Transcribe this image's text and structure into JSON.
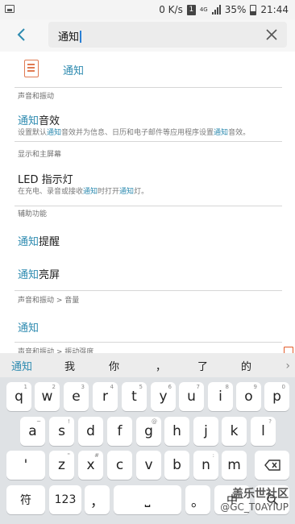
{
  "status_bar": {
    "speed": "0 K/s",
    "sim": "1",
    "network": "4G",
    "battery": "35%",
    "time": "21:44"
  },
  "search": {
    "query": "通知"
  },
  "top_result": {
    "title": "通知"
  },
  "results": [
    {
      "section": "声音和振动",
      "title_hl": "通知",
      "title_rest": "音效",
      "sub_parts": [
        "设置默认",
        "通知",
        "音效并为信息、日历和电子邮件等应用程序设置",
        "通知",
        "音效。"
      ]
    },
    {
      "section": "显示和主屏幕",
      "title": "LED 指示灯",
      "sub_parts": [
        "在充电、录音或接收",
        "通知",
        "时打开",
        "通知",
        "灯。"
      ]
    },
    {
      "section": "辅助功能",
      "title_hl": "通知",
      "title_rest": "提醒"
    },
    {
      "title_hl": "通知",
      "title_rest": "亮屏"
    },
    {
      "section": "声音和振动 > 音量",
      "title_hl": "通知"
    },
    {
      "section": "声音和振动 > 振动强度"
    }
  ],
  "keyboard": {
    "suggestions": [
      "通知",
      "我",
      "你",
      "，",
      "了",
      "的"
    ],
    "more": "›",
    "row1": [
      "q",
      "w",
      "e",
      "r",
      "t",
      "y",
      "u",
      "i",
      "o",
      "p"
    ],
    "row1_hints": [
      "1",
      "2",
      "3",
      "4",
      "5",
      "6",
      "7",
      "8",
      "9",
      "0"
    ],
    "row2": [
      "a",
      "s",
      "d",
      "f",
      "g",
      "h",
      "j",
      "k",
      "l"
    ],
    "row2_hints": [
      "~",
      "!",
      "",
      "",
      "@",
      "",
      "",
      "",
      "?"
    ],
    "row3": [
      "'",
      "z",
      "x",
      "c",
      "v",
      "b",
      "n",
      "m"
    ],
    "row3_hints": [
      "",
      "\"",
      "#",
      "",
      "",
      "",
      ":",
      ""
    ],
    "symbols": "符",
    "numbers": "123",
    "comma": "，",
    "period": "。",
    "lang": "中",
    "space_symbol": "⎵"
  },
  "watermark": {
    "line1": "盖乐世社区",
    "line2": "@GC_T0AYIUP"
  },
  "colors": {
    "accent": "#2e8bb0",
    "caret": "#2a7fd4",
    "app_icon": "#e07a52"
  }
}
